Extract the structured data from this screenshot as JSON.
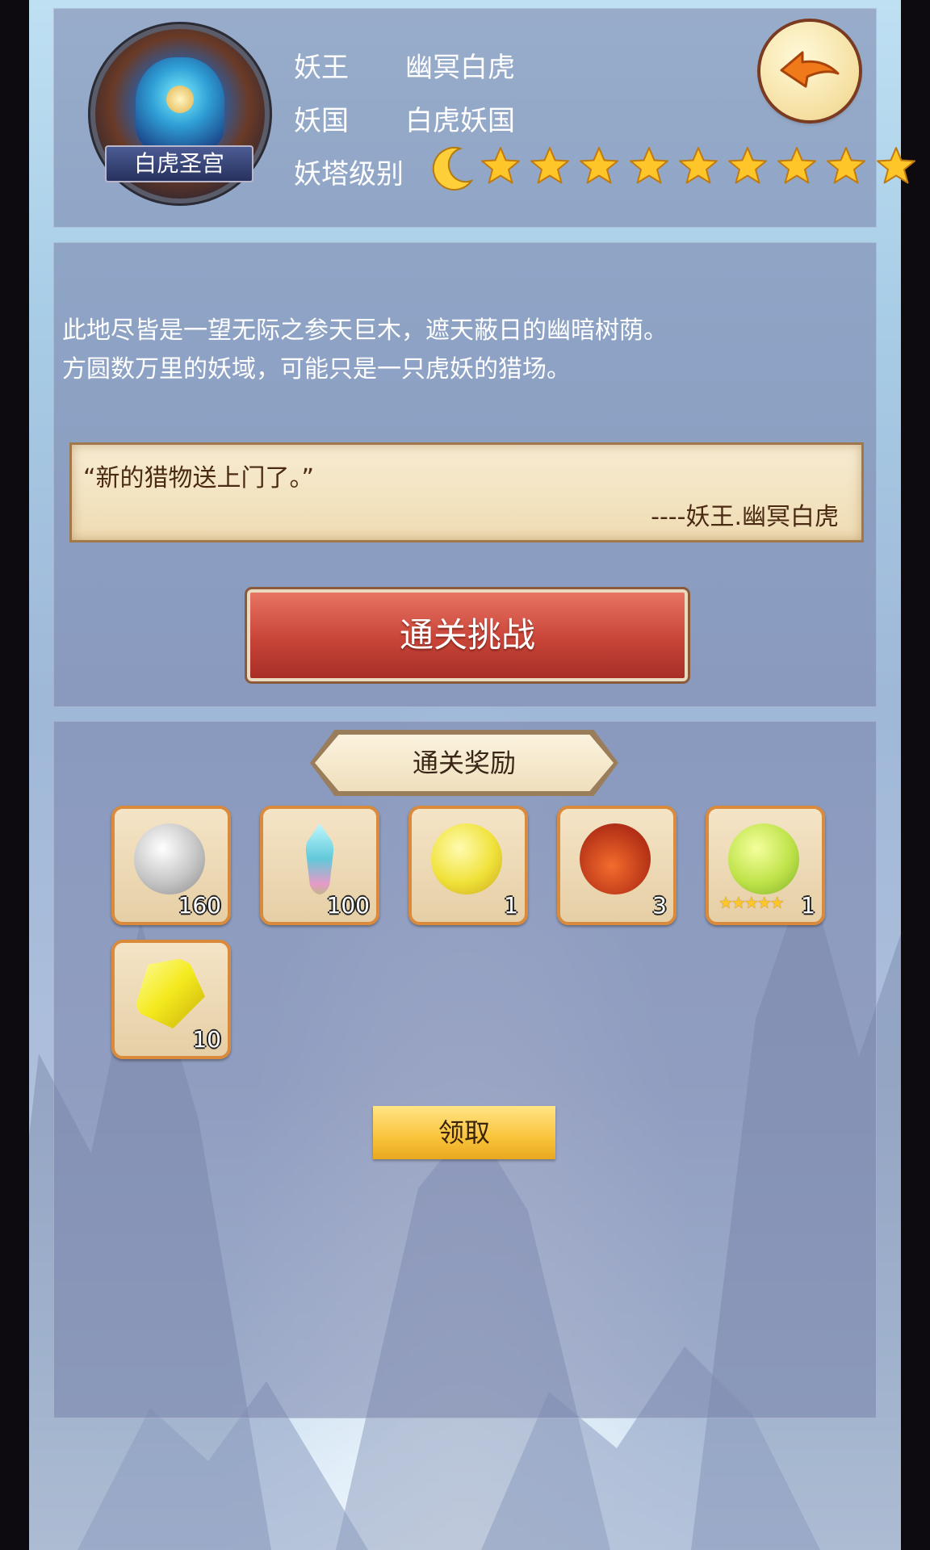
{
  "header": {
    "emblem_label": "白虎圣宫",
    "king_label": "妖王",
    "king_value": "幽冥白虎",
    "nation_label": "妖国",
    "nation_value": "白虎妖国",
    "tower_label": "妖塔级别",
    "tower_level": {
      "moon": 1,
      "stars": 9
    },
    "back_icon": "back-arrow-icon"
  },
  "description": {
    "line1": "此地尽皆是一望无际之参天巨木，遮天蔽日的幽暗树荫。",
    "line2": "方圆数万里的妖域，可能只是一只虎妖的猎场。"
  },
  "quote": {
    "text": "“新的猎物送上门了。”",
    "attribution": "----妖王.幽冥白虎"
  },
  "challenge_button": "通关挑战",
  "rewards": {
    "title": "通关奖励",
    "items": [
      {
        "icon": "silver-orb-icon",
        "count": "160"
      },
      {
        "icon": "jade-sword-icon",
        "count": "100"
      },
      {
        "icon": "golden-orb-icon",
        "count": "1"
      },
      {
        "icon": "wine-gourd-icon",
        "count": "3"
      },
      {
        "icon": "green-orb-icon",
        "count": "1",
        "stars": 5
      },
      {
        "icon": "yellow-crystal-icon",
        "count": "10"
      }
    ],
    "claim_button": "领取"
  },
  "colors": {
    "challenge": "#c94438",
    "claim": "#f9c33a",
    "slot_border": "#d98a3a",
    "star": "#ffc629"
  }
}
